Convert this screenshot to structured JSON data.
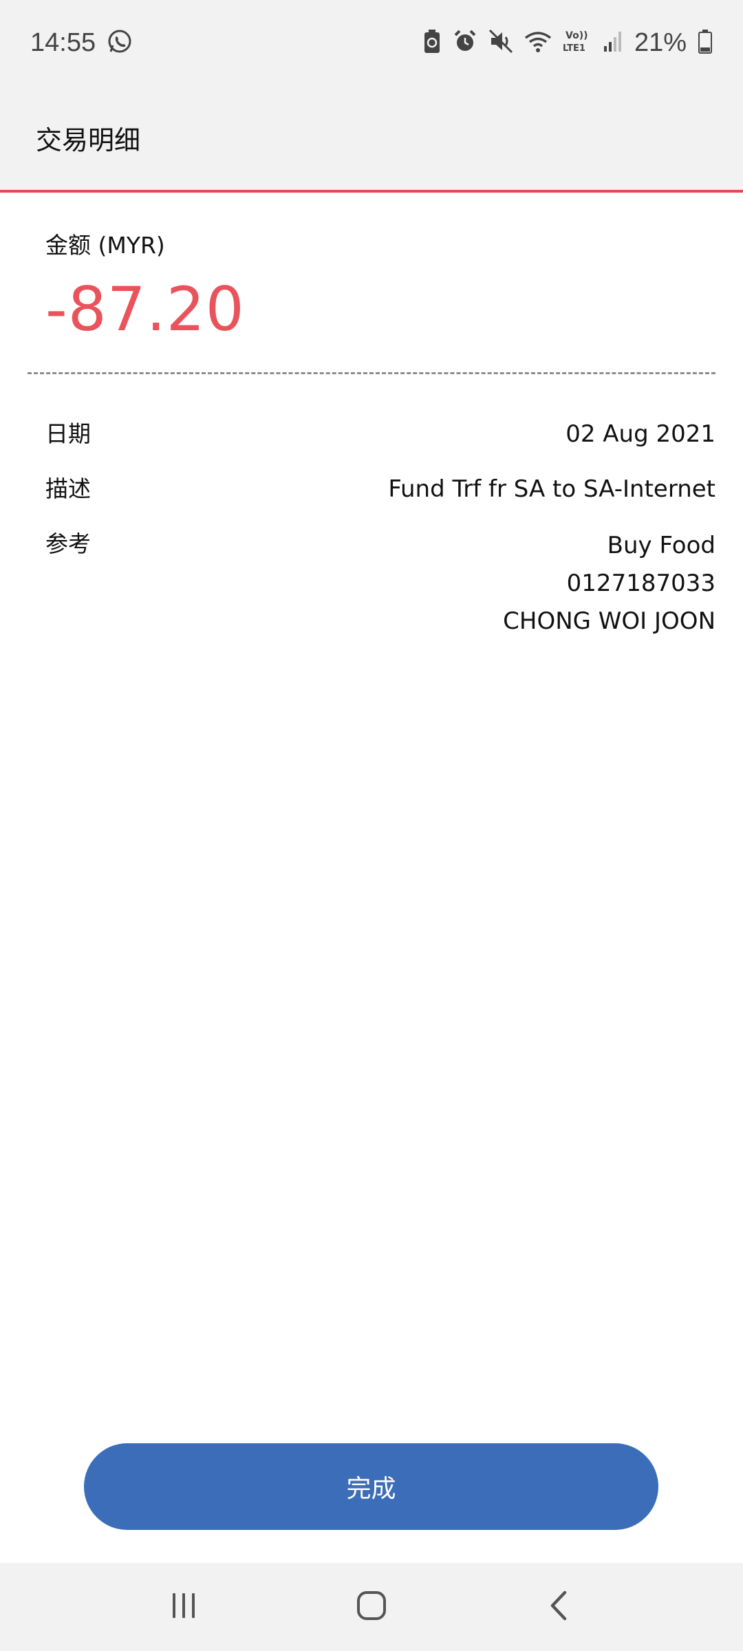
{
  "status_bar": {
    "time": "14:55",
    "battery_percent": "21%",
    "icons": [
      "whatsapp-icon",
      "battery-saver-icon",
      "alarm-icon",
      "mute-icon",
      "wifi-icon",
      "volte-lte-icon",
      "signal-icon",
      "battery-icon"
    ]
  },
  "header": {
    "title": "交易明细"
  },
  "amount": {
    "label": "金额 (MYR)",
    "value": "-87.20",
    "color": "#e9535b"
  },
  "details": {
    "date_label": "日期",
    "date_value": "02 Aug 2021",
    "description_label": "描述",
    "description_value": "Fund Trf fr SA to SA-Internet",
    "reference_label": "参考",
    "reference_lines": [
      "Buy Food",
      "0127187033",
      "CHONG WOI JOON"
    ]
  },
  "done_button": {
    "label": "完成",
    "color": "#3c6db9"
  },
  "nav_bar": {
    "icons": [
      "recent-apps-icon",
      "home-icon",
      "back-icon"
    ]
  },
  "colors": {
    "accent_red": "#e24a4e",
    "header_bg": "#f2f2f2"
  }
}
